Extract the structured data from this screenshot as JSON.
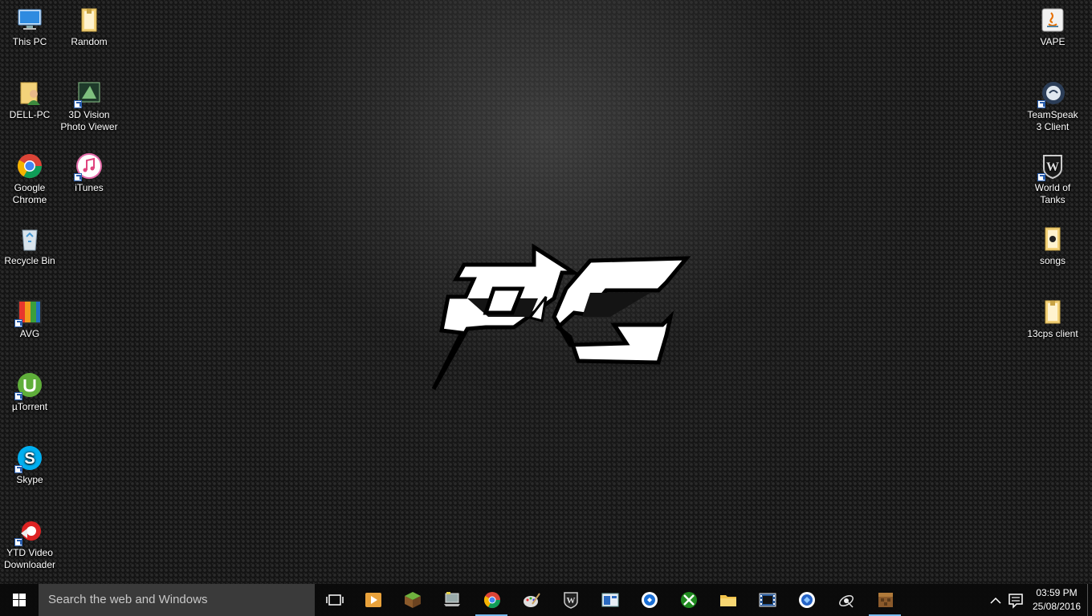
{
  "desktop": {
    "icons_left": [
      {
        "label": "This PC",
        "icon": "computer-icon",
        "shortcut": false
      },
      {
        "label": "Random",
        "icon": "folder-icon",
        "shortcut": false
      },
      {
        "label": "DELL-PC",
        "icon": "user-folder-icon",
        "shortcut": false
      },
      {
        "label": "3D Vision Photo Viewer",
        "icon": "3d-vision-icon",
        "shortcut": true
      },
      {
        "label": "Google Chrome",
        "icon": "chrome-icon",
        "shortcut": false
      },
      {
        "label": "iTunes",
        "icon": "itunes-icon",
        "shortcut": true
      },
      {
        "label": "Recycle Bin",
        "icon": "recycle-bin-icon",
        "shortcut": false
      },
      {
        "label": "AVG",
        "icon": "avg-icon",
        "shortcut": true
      },
      {
        "label": "µTorrent",
        "icon": "utorrent-icon",
        "shortcut": true
      },
      {
        "label": "Skype",
        "icon": "skype-icon",
        "shortcut": true
      },
      {
        "label": "YTD Video Downloader",
        "icon": "ytd-icon",
        "shortcut": true
      }
    ],
    "icons_right": [
      {
        "label": "VAPE",
        "icon": "java-jar-icon",
        "shortcut": false
      },
      {
        "label": "TeamSpeak 3 Client",
        "icon": "teamspeak-icon",
        "shortcut": true
      },
      {
        "label": "World of Tanks",
        "icon": "world-of-tanks-icon",
        "shortcut": true
      },
      {
        "label": "songs",
        "icon": "folder-icon",
        "shortcut": false
      },
      {
        "label": "13cps client",
        "icon": "folder-icon",
        "shortcut": false
      }
    ],
    "wallpaper": {
      "logo_text": "PC"
    }
  },
  "taskbar": {
    "search_placeholder": "Search the web and Windows",
    "pinned": [
      {
        "icon": "task-view-icon",
        "active": false
      },
      {
        "icon": "media-player-icon",
        "active": false
      },
      {
        "icon": "minecraft-icon",
        "active": false
      },
      {
        "icon": "laptop-app-icon",
        "active": false
      },
      {
        "icon": "chrome-icon",
        "active": true
      },
      {
        "icon": "paint-icon",
        "active": false
      },
      {
        "icon": "world-of-tanks-icon",
        "active": false
      },
      {
        "icon": "window-app-icon",
        "active": false
      },
      {
        "icon": "blue-circle-app-icon",
        "active": false
      },
      {
        "icon": "xbox-icon",
        "active": false
      },
      {
        "icon": "file-explorer-icon",
        "active": false
      },
      {
        "icon": "movie-maker-icon",
        "active": false
      },
      {
        "icon": "store-app-icon",
        "active": false
      },
      {
        "icon": "satellite-icon",
        "active": false
      },
      {
        "icon": "minecraft-launcher-icon",
        "active": true
      }
    ],
    "clock": {
      "time": "03:59 PM",
      "date": "25/08/2016"
    }
  },
  "colors": {
    "taskbar_bg": "#0a0a0a",
    "search_bg": "#3a3a3a",
    "accent": "#76b9ed",
    "windows_blue": "#ffffff"
  }
}
